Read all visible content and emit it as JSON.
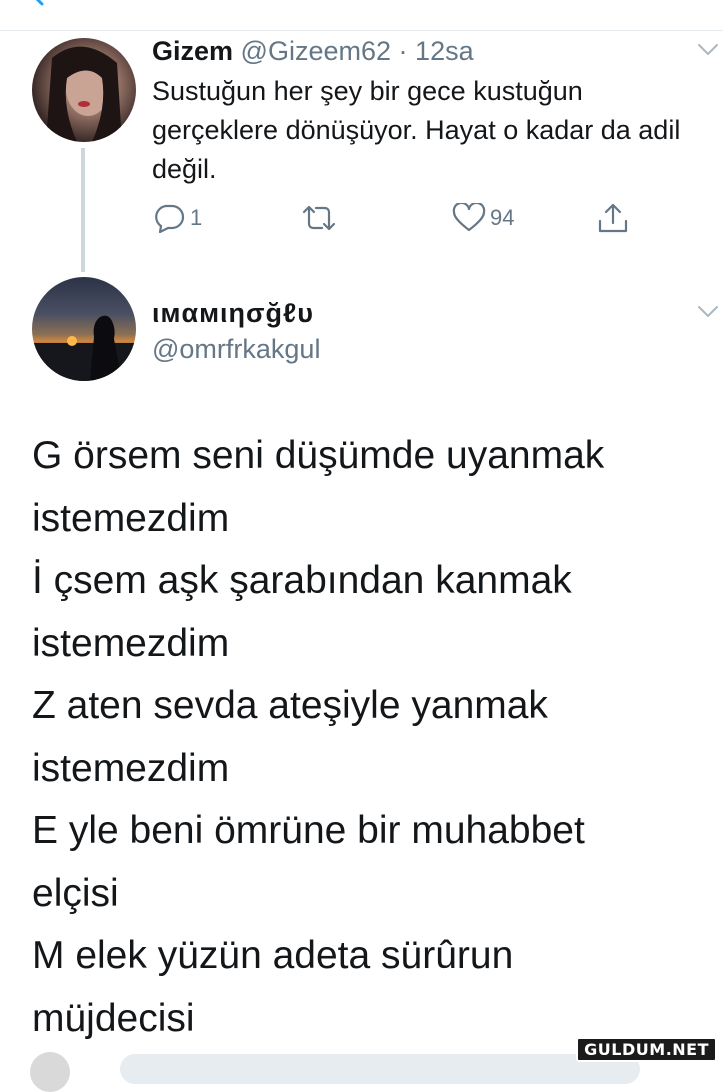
{
  "tweet1": {
    "name": "Gizem",
    "handle": "@Gizeem62",
    "separator": "·",
    "time": "12sa",
    "text": "Sustuğun her şey bir gece kustuğun gerçeklere dönüşüyor. Hayat o kadar da adil değil.",
    "reply_count": "1",
    "retweet_count": "",
    "like_count": "94"
  },
  "tweet2": {
    "name": "ιмαмιησğℓυ",
    "handle": "@omrfrkakgul",
    "poem_lines": [
      "G örsem seni düşümde uyanmak",
      "istemezdim",
      "İ  çsem aşk şarabından kanmak",
      "istemezdim",
      "Z aten sevda ateşiyle yanmak",
      "istemezdim",
      "E yle beni ömrüne bir muhabbet",
      "elçisi",
      "M elek yüzün adeta sürûrun",
      "müjdecisi"
    ]
  },
  "watermark": "GULDUM.NET",
  "icons": {
    "reply": "reply-icon",
    "retweet": "retweet-icon",
    "like": "like-icon",
    "share": "share-icon",
    "more": "chevron-down-icon",
    "back": "back-icon"
  },
  "colors": {
    "text": "#14171a",
    "secondary": "#657786",
    "thread_line": "#ccd6dd",
    "divider": "#e6ecf0"
  }
}
